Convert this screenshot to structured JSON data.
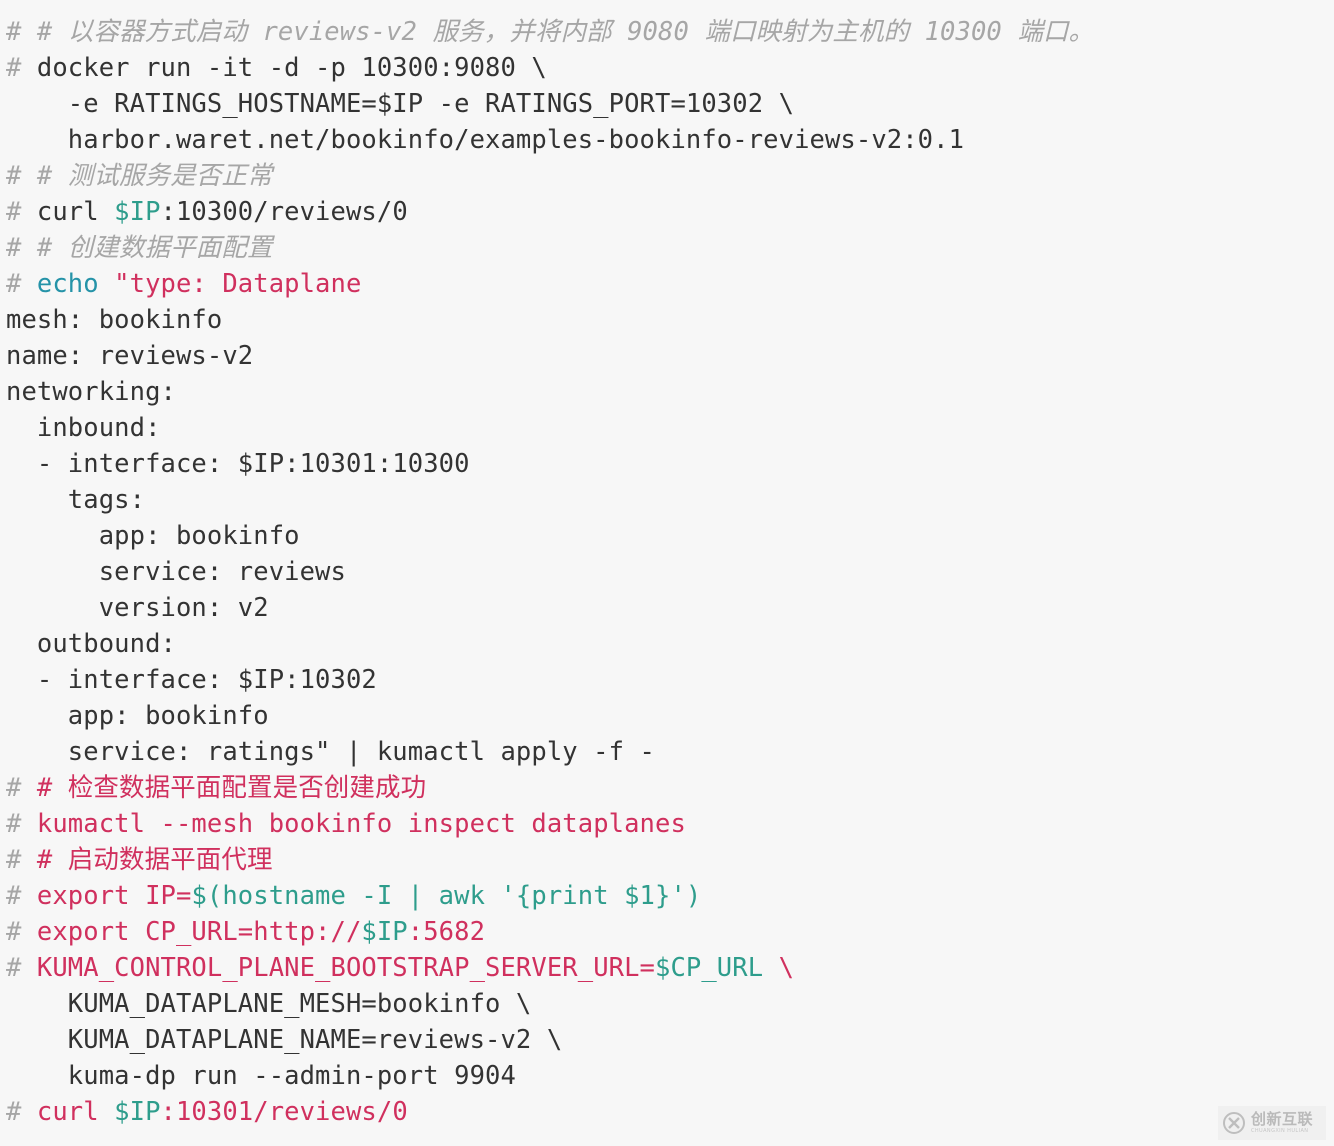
{
  "code_block": {
    "language": "shell",
    "background_color": "#f7f7f7",
    "colors": {
      "prompt": "#a6a6a6",
      "comment": "#a6a6a6",
      "plain": "#333333",
      "crimson": "#d0305e",
      "teal": "#2e9d8c",
      "blue_teal": "#2593a8"
    },
    "lines": [
      {
        "id": 1,
        "tokens": [
          {
            "t": "# ",
            "c": "prompt"
          },
          {
            "t": "# 以容器方式启动 reviews-v2 服务，并将内部 9080 端口映射为主机的 10300 端口。",
            "c": "comment"
          }
        ]
      },
      {
        "id": 2,
        "tokens": [
          {
            "t": "# ",
            "c": "prompt"
          },
          {
            "t": "docker run -it -d -p 10300:9080 \\",
            "c": "plain"
          }
        ]
      },
      {
        "id": 3,
        "tokens": [
          {
            "t": "    -e RATINGS_HOSTNAME=$IP -e RATINGS_PORT=10302 \\",
            "c": "plain"
          }
        ]
      },
      {
        "id": 4,
        "tokens": [
          {
            "t": "    harbor.waret.net/bookinfo/examples-bookinfo-reviews-v2:0.1",
            "c": "plain"
          }
        ]
      },
      {
        "id": 5,
        "tokens": [
          {
            "t": "# ",
            "c": "prompt"
          },
          {
            "t": "# 测试服务是否正常",
            "c": "comment"
          }
        ]
      },
      {
        "id": 6,
        "tokens": [
          {
            "t": "# ",
            "c": "prompt"
          },
          {
            "t": "curl ",
            "c": "plain"
          },
          {
            "t": "$IP",
            "c": "teal"
          },
          {
            "t": ":10300/reviews/0",
            "c": "plain"
          }
        ]
      },
      {
        "id": 7,
        "tokens": [
          {
            "t": "# ",
            "c": "prompt"
          },
          {
            "t": "# 创建数据平面配置",
            "c": "comment"
          }
        ]
      },
      {
        "id": 8,
        "tokens": [
          {
            "t": "# ",
            "c": "prompt"
          },
          {
            "t": "echo ",
            "c": "blue_teal"
          },
          {
            "t": "\"type: Dataplane",
            "c": "crimson"
          }
        ]
      },
      {
        "id": 9,
        "tokens": [
          {
            "t": "mesh: bookinfo",
            "c": "plain"
          }
        ]
      },
      {
        "id": 10,
        "tokens": [
          {
            "t": "name: reviews-v2",
            "c": "plain"
          }
        ]
      },
      {
        "id": 11,
        "tokens": [
          {
            "t": "networking:",
            "c": "plain"
          }
        ]
      },
      {
        "id": 12,
        "tokens": [
          {
            "t": "  inbound:",
            "c": "plain"
          }
        ]
      },
      {
        "id": 13,
        "tokens": [
          {
            "t": "  - interface: $IP:10301:10300",
            "c": "plain"
          }
        ]
      },
      {
        "id": 14,
        "tokens": [
          {
            "t": "    tags:",
            "c": "plain"
          }
        ]
      },
      {
        "id": 15,
        "tokens": [
          {
            "t": "      app: bookinfo",
            "c": "plain"
          }
        ]
      },
      {
        "id": 16,
        "tokens": [
          {
            "t": "      service: reviews",
            "c": "plain"
          }
        ]
      },
      {
        "id": 17,
        "tokens": [
          {
            "t": "      version: v2",
            "c": "plain"
          }
        ]
      },
      {
        "id": 18,
        "tokens": [
          {
            "t": "  outbound:",
            "c": "plain"
          }
        ]
      },
      {
        "id": 19,
        "tokens": [
          {
            "t": "  - interface: $IP:10302",
            "c": "plain"
          }
        ]
      },
      {
        "id": 20,
        "tokens": [
          {
            "t": "    app: bookinfo",
            "c": "plain"
          }
        ]
      },
      {
        "id": 21,
        "tokens": [
          {
            "t": "    service: ratings\" | kumactl apply -f -",
            "c": "plain"
          }
        ]
      },
      {
        "id": 22,
        "tokens": [
          {
            "t": "# ",
            "c": "prompt"
          },
          {
            "t": "# 检查数据平面配置是否创建成功",
            "c": "crimson"
          }
        ]
      },
      {
        "id": 23,
        "tokens": [
          {
            "t": "# ",
            "c": "prompt"
          },
          {
            "t": "kumactl --mesh bookinfo inspect dataplanes",
            "c": "crimson"
          }
        ]
      },
      {
        "id": 24,
        "tokens": [
          {
            "t": "# ",
            "c": "prompt"
          },
          {
            "t": "# 启动数据平面代理",
            "c": "crimson"
          }
        ]
      },
      {
        "id": 25,
        "tokens": [
          {
            "t": "# ",
            "c": "prompt"
          },
          {
            "t": "export IP=",
            "c": "crimson"
          },
          {
            "t": "$(hostname -I | awk '{print $1}')",
            "c": "teal"
          }
        ]
      },
      {
        "id": 26,
        "tokens": [
          {
            "t": "# ",
            "c": "prompt"
          },
          {
            "t": "export CP_URL=http://",
            "c": "crimson"
          },
          {
            "t": "$IP",
            "c": "teal"
          },
          {
            "t": ":5682",
            "c": "crimson"
          }
        ]
      },
      {
        "id": 27,
        "tokens": [
          {
            "t": "# ",
            "c": "prompt"
          },
          {
            "t": "KUMA_CONTROL_PLANE_BOOTSTRAP_SERVER_URL=",
            "c": "crimson"
          },
          {
            "t": "$CP_URL",
            "c": "teal"
          },
          {
            "t": " \\",
            "c": "crimson"
          }
        ]
      },
      {
        "id": 28,
        "tokens": [
          {
            "t": "    KUMA_DATAPLANE_MESH=bookinfo \\",
            "c": "plain"
          }
        ]
      },
      {
        "id": 29,
        "tokens": [
          {
            "t": "    KUMA_DATAPLANE_NAME=reviews-v2 \\",
            "c": "plain"
          }
        ]
      },
      {
        "id": 30,
        "tokens": [
          {
            "t": "    kuma-dp run --admin-port 9904",
            "c": "plain"
          }
        ]
      },
      {
        "id": 31,
        "tokens": [
          {
            "t": "# ",
            "c": "prompt"
          },
          {
            "t": "curl ",
            "c": "crimson"
          },
          {
            "t": "$IP",
            "c": "teal"
          },
          {
            "t": ":10301/reviews/0",
            "c": "crimson"
          }
        ]
      }
    ]
  },
  "watermark": {
    "cn_text": "创新互联",
    "en_text": "CHUANGXIN HULIAN",
    "color": "#b0b0b0"
  }
}
